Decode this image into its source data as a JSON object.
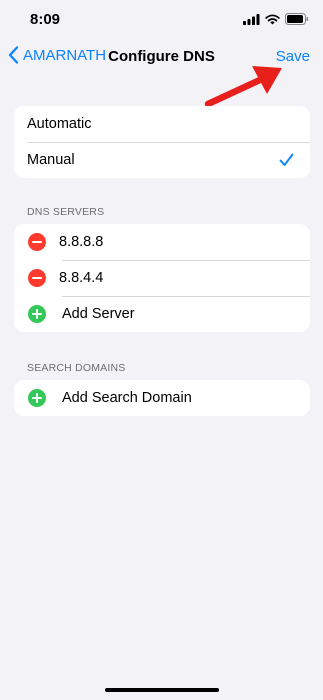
{
  "status_bar": {
    "time": "8:09"
  },
  "nav": {
    "back_label": "AMARNATH",
    "title": "Configure DNS",
    "save_label": "Save"
  },
  "mode": {
    "options": [
      {
        "label": "Automatic",
        "selected": false
      },
      {
        "label": "Manual",
        "selected": true
      }
    ]
  },
  "dns_servers": {
    "header": "DNS SERVERS",
    "servers": [
      "8.8.8.8",
      "8.8.4.4"
    ],
    "add_label": "Add Server"
  },
  "search_domains": {
    "header": "SEARCH DOMAINS",
    "add_label": "Add Search Domain"
  },
  "colors": {
    "accent": "#0a84ff",
    "delete": "#ff3b30",
    "add": "#34c759",
    "annotation_arrow": "#e8201c"
  },
  "icons": {
    "back": "chevron-left-icon",
    "selected": "checkmark-icon",
    "delete": "minus-circle-icon",
    "add": "plus-circle-icon"
  }
}
